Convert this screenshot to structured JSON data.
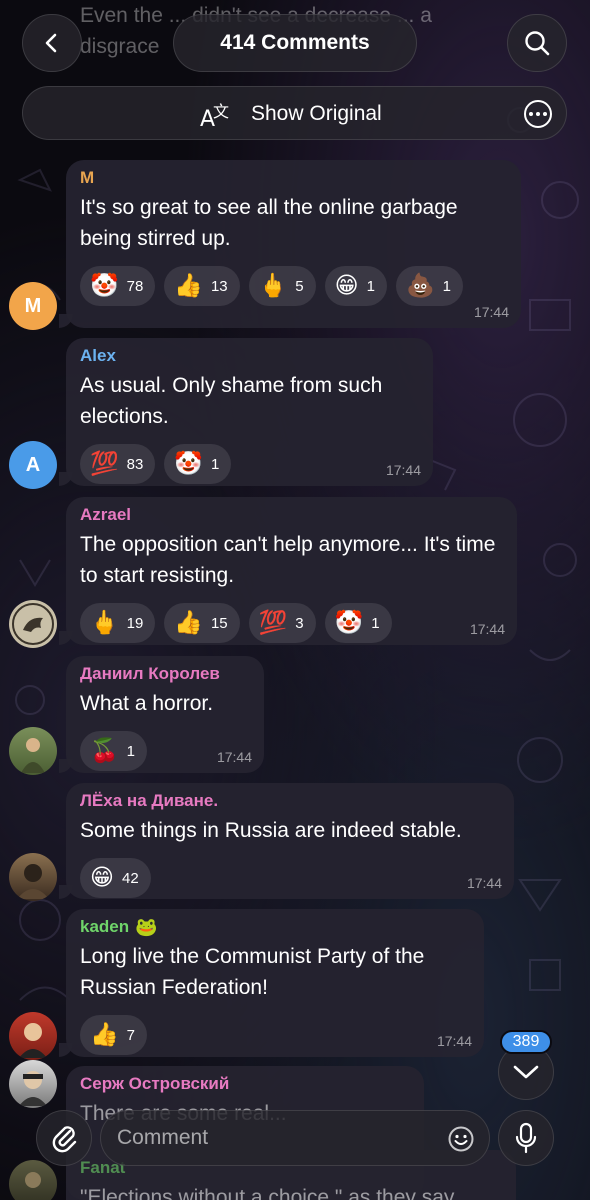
{
  "header": {
    "title": "414 Comments",
    "translate_label": "Show Original",
    "partial_text": "Even the ... didn't see a decrease ... a disgrace"
  },
  "messages": [
    {
      "sender": "M",
      "sender_color": "#e8a550",
      "avatar_letter": "M",
      "avatar_color": "#f2a54a",
      "text": "It's so great to see all the online garbage being stirred up.",
      "time": "17:44",
      "reactions": [
        {
          "emoji": "🤡",
          "count": "78"
        },
        {
          "emoji": "👍",
          "count": "13"
        },
        {
          "emoji": "🖕",
          "count": "5"
        },
        {
          "emoji": "😁",
          "count": "1"
        },
        {
          "emoji": "💩",
          "count": "1"
        }
      ]
    },
    {
      "sender": "Alex",
      "sender_color": "#6cb2f0",
      "avatar_letter": "A",
      "avatar_color": "#4a9be8",
      "text": "As usual. Only shame from such elections.",
      "time": "17:44",
      "reactions": [
        {
          "emoji": "💯",
          "count": "83"
        },
        {
          "emoji": "🤡",
          "count": "1"
        }
      ]
    },
    {
      "sender": "Azrael",
      "sender_color": "#e77ac1",
      "text": "The opposition can't help anymore... It's time to start resisting.",
      "time": "17:44",
      "reactions": [
        {
          "emoji": "🖕",
          "count": "19"
        },
        {
          "emoji": "👍",
          "count": "15"
        },
        {
          "emoji": "💯",
          "count": "3"
        },
        {
          "emoji": "🤡",
          "count": "1"
        }
      ]
    },
    {
      "sender": "Даниил Королев",
      "sender_color": "#e77ac1",
      "text": "What a horror.",
      "time": "17:44",
      "reactions": [
        {
          "emoji": "🍒",
          "count": "1"
        }
      ]
    },
    {
      "sender": "ЛЁха на Диване.",
      "sender_color": "#e77ac1",
      "text": "Some things in Russia are indeed stable.",
      "time": "17:44",
      "reactions": [
        {
          "emoji": "😁",
          "count": "42"
        }
      ]
    },
    {
      "sender": "kaden",
      "sender_color": "#6fd46a",
      "sender_badge": "🐸",
      "text": "Long live the Communist Party of the Russian Federation!",
      "time": "17:44",
      "reactions": [
        {
          "emoji": "👍",
          "count": "7"
        }
      ]
    }
  ],
  "partial_messages": [
    {
      "sender": "Серж Островский",
      "sender_color": "#e77ac1",
      "text": "There are some real..."
    },
    {
      "sender": "Fanat",
      "sender_color": "#6fd46a",
      "text": "\"Elections without a choice,\" as they say"
    }
  ],
  "scroll_badge": "389",
  "composer": {
    "placeholder": "Comment"
  }
}
